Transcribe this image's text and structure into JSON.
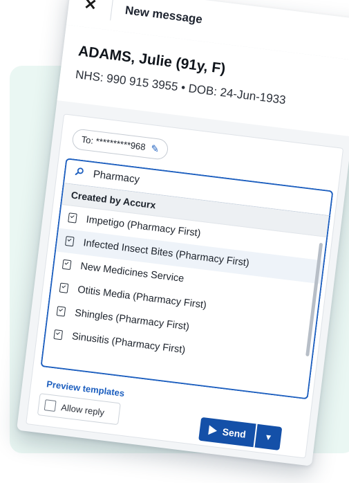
{
  "header": {
    "close_glyph": "✕",
    "title": "New message"
  },
  "patient": {
    "name": "ADAMS, Julie (91y, F)",
    "ids": "NHS: 990 915 3955 • DOB: 24-Jun-1933"
  },
  "recipient": {
    "label": "To: **********968",
    "edit_icon": "pencil-icon"
  },
  "search": {
    "value": "Pharmacy",
    "icon": "search-icon"
  },
  "templates": {
    "group_label": "Created by Accurx",
    "items": [
      {
        "label": "Impetigo (Pharmacy First)"
      },
      {
        "label": "Infected Insect Bites (Pharmacy First)"
      },
      {
        "label": "New Medicines Service"
      },
      {
        "label": "Otitis Media (Pharmacy First)"
      },
      {
        "label": "Shingles (Pharmacy First)"
      },
      {
        "label": "Sinusitis (Pharmacy First)"
      }
    ],
    "highlighted_index": 1
  },
  "footer": {
    "preview_label": "Preview templates",
    "allow_reply_label": "Allow reply",
    "allow_reply_checked": false,
    "send_label": "Send"
  },
  "colors": {
    "accent": "#1d5fbf",
    "send": "#1450a8",
    "background_panel": "#eaf7f3"
  }
}
